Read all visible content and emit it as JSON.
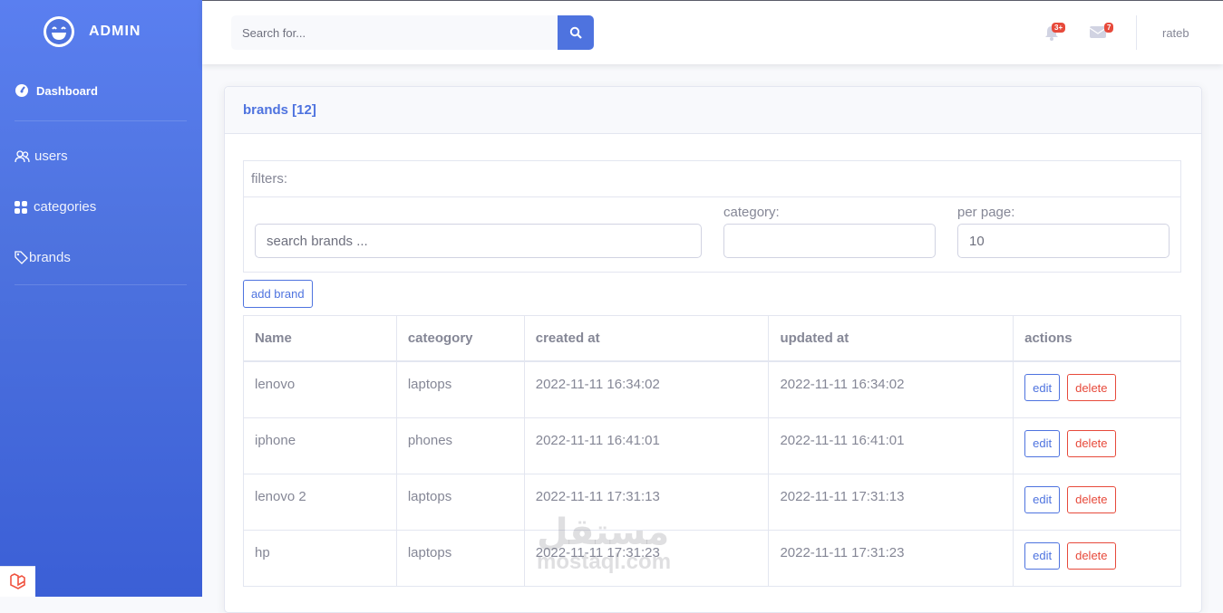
{
  "sidebar": {
    "brand": "ADMIN",
    "items": [
      {
        "label": "Dashboard",
        "icon": "tachometer-icon"
      },
      {
        "label": "users",
        "icon": "users-icon"
      },
      {
        "label": "categories",
        "icon": "grid-icon"
      },
      {
        "label": "brands",
        "icon": "tag-icon"
      }
    ]
  },
  "topbar": {
    "search_placeholder": "Search for...",
    "alerts_badge": "3+",
    "messages_badge": "7",
    "username": "rateb"
  },
  "card": {
    "title": "brands [12]",
    "filters_title": "filters:",
    "search_placeholder": "search brands ...",
    "category_label": "category:",
    "category_value": "",
    "per_page_label": "per page:",
    "per_page_value": "10",
    "add_button": "add brand"
  },
  "table": {
    "headers": [
      "Name",
      "cateogory",
      "created at",
      "updated at",
      "actions"
    ],
    "rows": [
      {
        "name": "lenovo",
        "category": "laptops",
        "created_at": "2022-11-11 16:34:02",
        "updated_at": "2022-11-11 16:34:02"
      },
      {
        "name": "iphone",
        "category": "phones",
        "created_at": "2022-11-11 16:41:01",
        "updated_at": "2022-11-11 16:41:01"
      },
      {
        "name": "lenovo 2",
        "category": "laptops",
        "created_at": "2022-11-11 17:31:13",
        "updated_at": "2022-11-11 17:31:13"
      },
      {
        "name": "hp",
        "category": "laptops",
        "created_at": "2022-11-11 17:31:23",
        "updated_at": "2022-11-11 17:31:23"
      }
    ],
    "edit_label": "edit",
    "delete_label": "delete"
  },
  "watermark": {
    "arabic": "مستقل",
    "latin": "mostaql.com"
  },
  "colors": {
    "primary": "#4e73df",
    "danger": "#e74a3b",
    "text": "#858796"
  }
}
